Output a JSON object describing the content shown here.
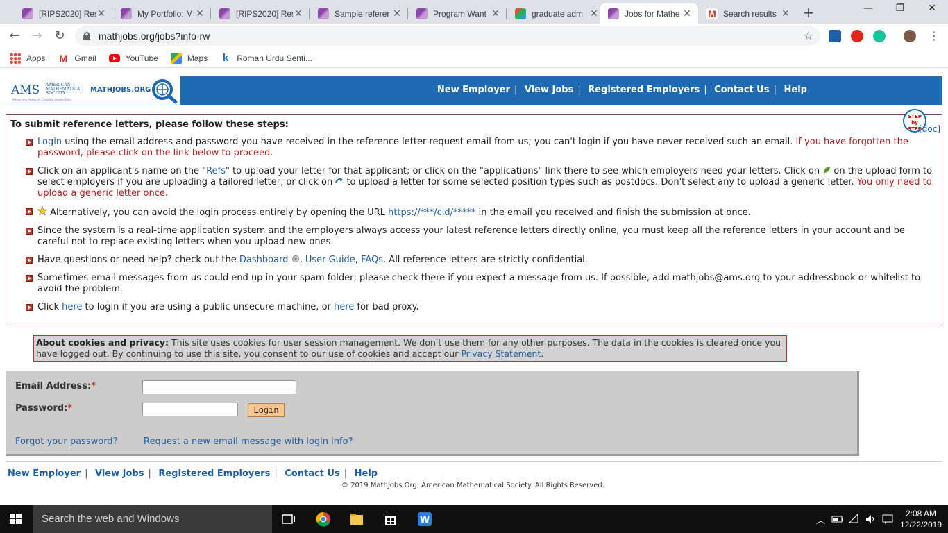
{
  "browser": {
    "tabs": [
      {
        "title": "[RIPS2020] Res",
        "favicon": "purple",
        "active": false
      },
      {
        "title": "My Portfolio: M",
        "favicon": "purple",
        "active": false
      },
      {
        "title": "[RIPS2020] Res",
        "favicon": "purple",
        "active": false
      },
      {
        "title": "Sample referer",
        "favicon": "purple",
        "active": false
      },
      {
        "title": "Program Want",
        "favicon": "purple",
        "active": false
      },
      {
        "title": "graduate adm",
        "favicon": "tri",
        "active": false
      },
      {
        "title": "Jobs for Mathe",
        "favicon": "purple",
        "active": true
      },
      {
        "title": "Search results",
        "favicon": "gmail",
        "active": false
      }
    ],
    "new_tab_label": "+",
    "minimize_label": "—",
    "restore_label": "❐",
    "close_label": "✕",
    "url": "mathjobs.org/jobs?info-rw",
    "bookmarks": [
      {
        "label": "Apps",
        "icon": "apps"
      },
      {
        "label": "Gmail",
        "icon": "gmail"
      },
      {
        "label": "YouTube",
        "icon": "youtube"
      },
      {
        "label": "Maps",
        "icon": "maps"
      },
      {
        "label": "Roman Urdu Senti...",
        "icon": "k"
      }
    ]
  },
  "header": {
    "logo_ams": "AMS",
    "logo_ams_full": "AMERICAN MATHEMATICAL SOCIETY",
    "logo_tagline": "Advancing research. Creating connections.",
    "logo_mathjobs": "MATHJOBS.ORG",
    "nav": [
      "New Employer",
      "View Jobs",
      "Registered Employers",
      "Contact Us",
      "Help"
    ]
  },
  "steps": {
    "title": "To submit reference letters, please follow these steps:",
    "badge": "STEP by STEP",
    "doc_link": "[doc]",
    "items": {
      "s1_link": "Login",
      "s1_text": " using the email address and password you have received in the reference letter request email from us; you can't login if you have never received such an email. ",
      "s1_warn": "If you have forgotten the password, please click on the link below to proceed.",
      "s2_a": "Click on an applicant's name on the \"",
      "s2_refs": "Refs",
      "s2_b": "\" to upload your letter for that applicant; or click on the \"applications\" link there to see which employers need your letters. Click on ",
      "s2_c": " on the upload form to select employers if you are uploading a tailored letter, or click on ",
      "s2_d": " to upload a letter for some selected position types such as postdocs. Don't select any to upload a generic letter. ",
      "s2_warn": "You only need to upload a generic letter once.",
      "s3_a": " Alternatively, you can avoid the login process entirely by opening the URL ",
      "s3_url": "https://***/cid/*****",
      "s3_b": " in the email you received and finish the submission at once.",
      "s4": "Since the system is a real-time application system and the employers always access your latest reference letters directly online, you must keep all the reference letters in your account and be careful not to replace existing letters when you upload new ones.",
      "s5_a": "Have questions or need help? check out the ",
      "s5_dash": "Dashboard",
      "s5_b": ", ",
      "s5_guide": "User Guide",
      "s5_c": ", ",
      "s5_faq": "FAQs",
      "s5_d": ". All reference letters are strictly confidential.",
      "s6": "Sometimes email messages from us could end up in your spam folder; please check there if you expect a message from us. If possible, add mathjobs@ams.org to your addressbook or whitelist to avoid the problem.",
      "s7_a": "Click ",
      "s7_here1": "here",
      "s7_b": " to login if you are using a public unsecure machine, or ",
      "s7_here2": "here",
      "s7_c": " for bad proxy."
    }
  },
  "cookies": {
    "title": "About cookies and privacy:",
    "text": " This site uses cookies for user session management. We don't use them for any other purposes. The data in the cookies is cleared once you have logged out. By continuing to use this site, you consent to our use of cookies and accept our ",
    "link": "Privacy Statement",
    "end": "."
  },
  "login": {
    "email_label": "Email Address:",
    "password_label": "Password:",
    "required_mark": "*",
    "email_value": "",
    "password_value": "",
    "login_button": "Login",
    "forgot_link": "Forgot your password?",
    "request_link": "Request a new email message with login info?"
  },
  "footer": {
    "nav": [
      "New Employer",
      "View Jobs",
      "Registered Employers",
      "Contact Us",
      "Help"
    ],
    "copyright": "© 2019 MathJobs.Org, American Mathematical Society. All Rights Reserved."
  },
  "taskbar": {
    "search_placeholder": "Search the web and Windows",
    "time": "2:08 AM",
    "date": "12/22/2019"
  },
  "colors": {
    "banner": "#1e6ab3",
    "link": "#1e5fa8",
    "warning": "#b22222",
    "login_button": "#f9c58d"
  }
}
